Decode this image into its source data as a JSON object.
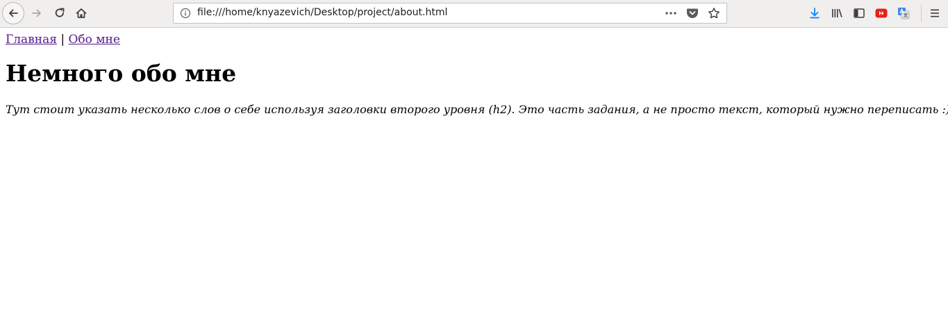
{
  "browser": {
    "url": "file:///home/knyazevich/Desktop/project/about.html",
    "icons": {
      "back": "back-arrow-icon",
      "forward": "forward-arrow-icon",
      "reload": "reload-icon",
      "home": "home-icon",
      "info": "info-icon",
      "page_actions": "more-dots-icon",
      "pocket": "pocket-icon",
      "bookmark": "star-icon",
      "downloads": "download-icon",
      "library": "library-icon",
      "sidebar": "sidebar-icon",
      "youtube_ext": "youtube-icon",
      "translate_ext": "translate-icon",
      "menu": "hamburger-menu-icon"
    },
    "colors": {
      "download_accent": "#0a84ff",
      "youtube_red": "#e62117",
      "translate_blue": "#4285f4"
    }
  },
  "page": {
    "nav": {
      "home_link": "Главная",
      "separator": "|",
      "about_link": "Обо мне"
    },
    "heading": "Немного обо мне",
    "paragraph": "Тут стоит указать несколько слов о себе используя заголовки второго уровня (h2). Это часть задания, а не просто текст, который нужно переписать :)",
    "colors": {
      "visited_link": "#551a8b"
    }
  }
}
